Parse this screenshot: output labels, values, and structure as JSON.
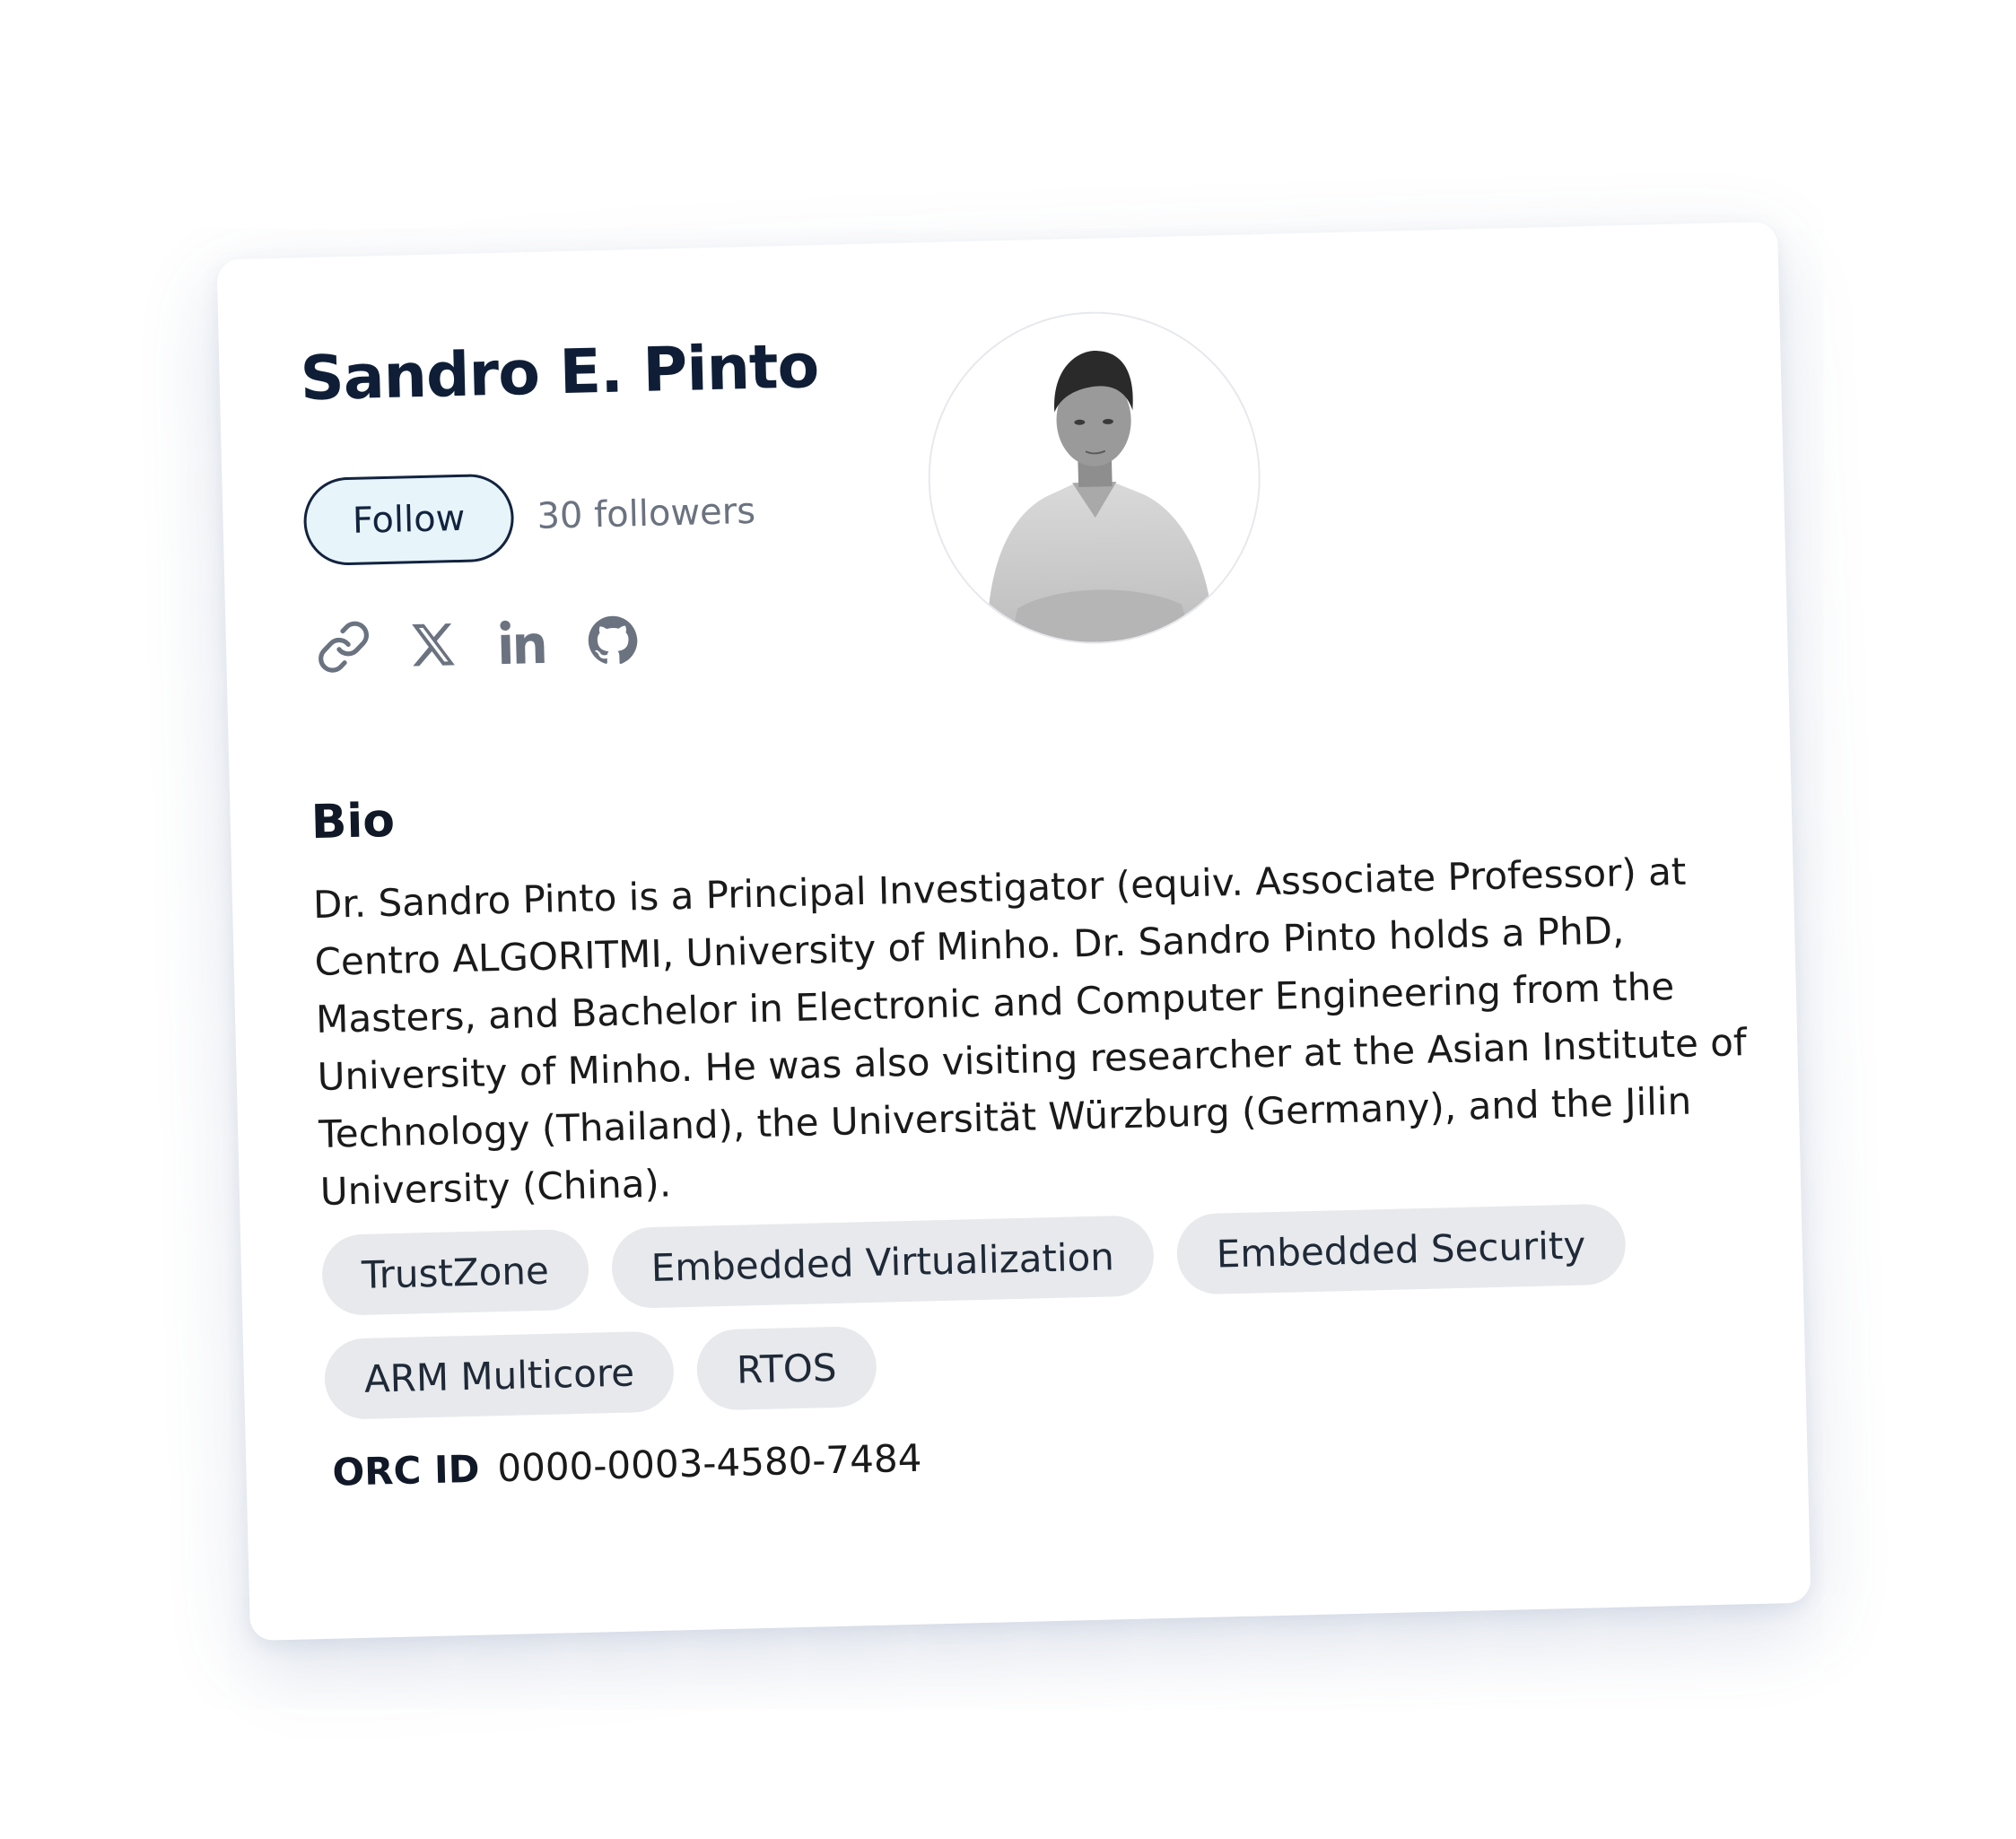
{
  "profile": {
    "name": "Sandro E. Pinto",
    "follow_label": "Follow",
    "followers_text": "30 followers"
  },
  "socials": [
    {
      "icon": "link-icon"
    },
    {
      "icon": "x-twitter-icon"
    },
    {
      "icon": "linkedin-icon"
    },
    {
      "icon": "github-icon"
    }
  ],
  "bio": {
    "heading": "Bio",
    "text": "Dr. Sandro Pinto is a Principal Investigator (equiv. Associate Professor) at Centro ALGORITMI, University of Minho. Dr. Sandro Pinto holds a PhD, Masters, and Bachelor in Electronic and Computer Engineering from the University of Minho. He was also visiting researcher at the Asian Institute of Technology (Thailand), the Universität Würzburg (Germany), and the Jilin University (China)."
  },
  "tags": [
    "TrustZone",
    "Embedded Virtualization",
    "Embedded Security",
    "ARM Multicore",
    "RTOS"
  ],
  "orcid": {
    "label": "ORC ID",
    "value": "0000-0003-4580-7484"
  },
  "colors": {
    "name": "#0f1e36",
    "follow_bg": "#e7f5fb",
    "follow_border": "#13233f",
    "muted": "#6b7280",
    "tag_bg": "#e7e9ec"
  }
}
